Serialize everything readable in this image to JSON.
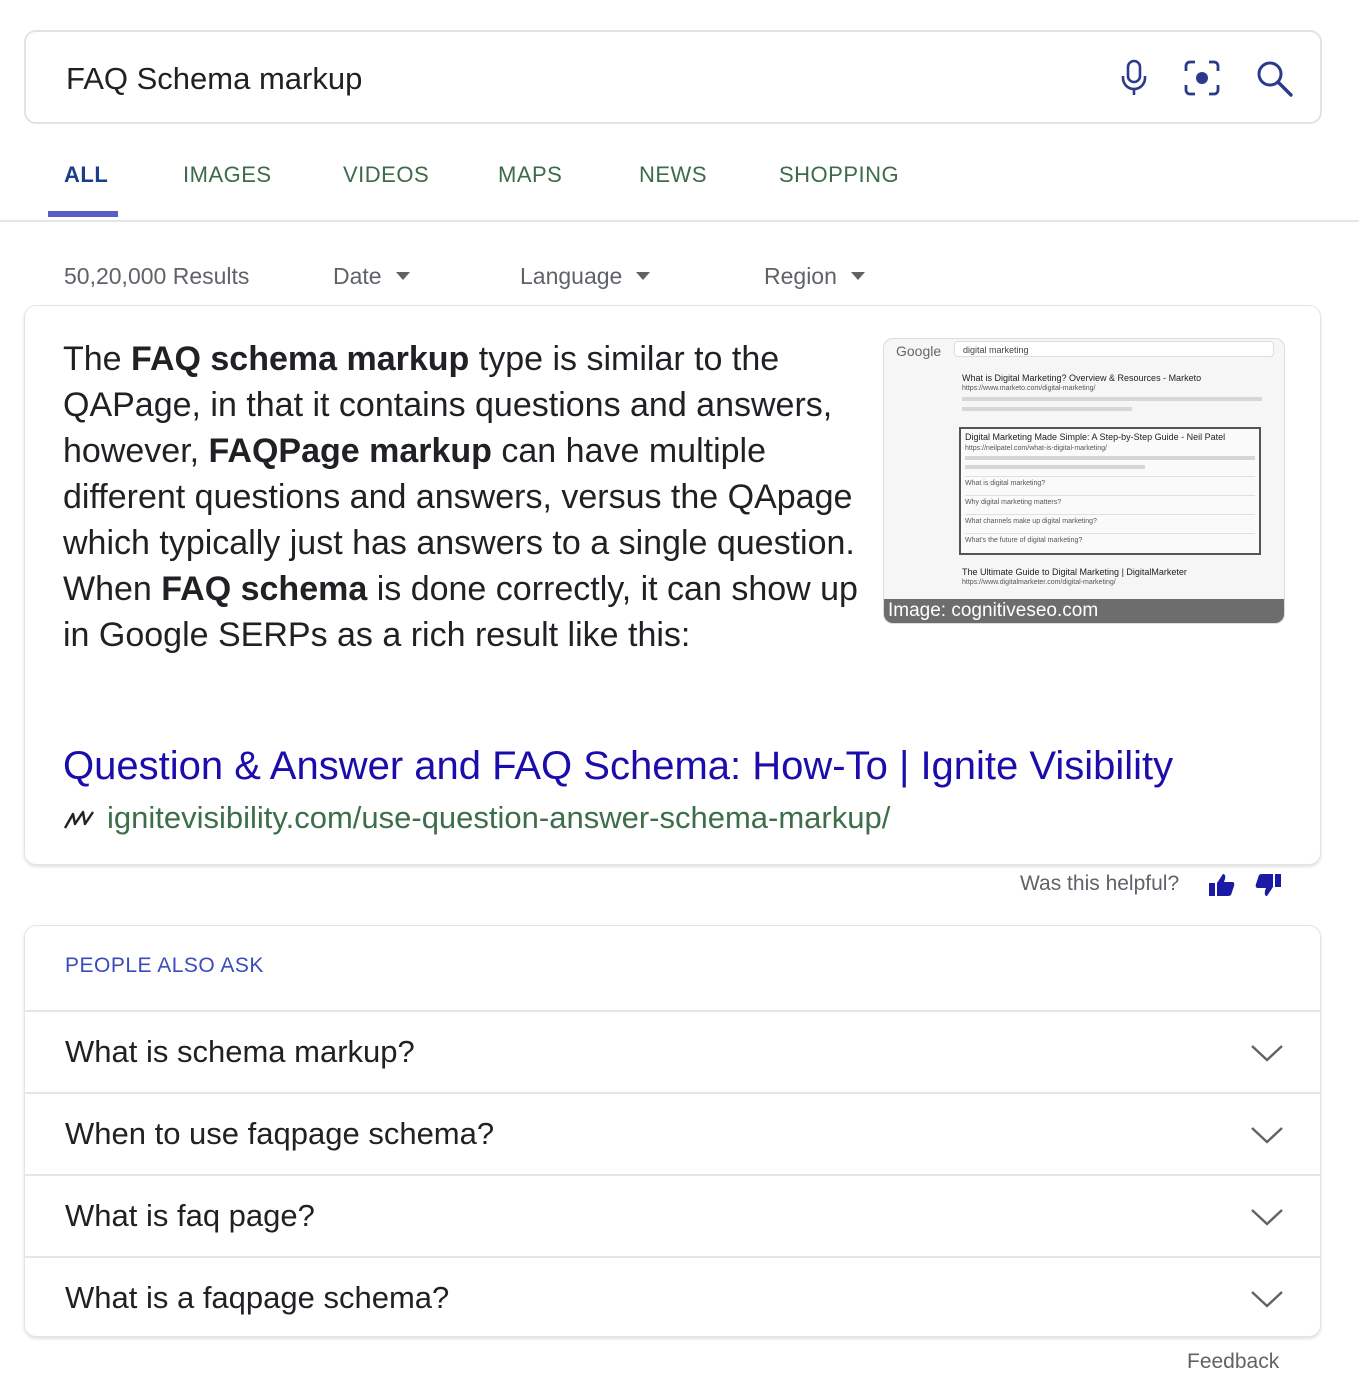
{
  "search": {
    "query": "FAQ Schema markup",
    "icons": [
      "microphone-icon",
      "lens-icon",
      "search-icon"
    ]
  },
  "tabs": [
    {
      "label": "ALL",
      "active": true
    },
    {
      "label": "IMAGES"
    },
    {
      "label": "VIDEOS"
    },
    {
      "label": "MAPS"
    },
    {
      "label": "NEWS"
    },
    {
      "label": "SHOPPING"
    }
  ],
  "filters": {
    "results_count": "50,20,000 Results",
    "date": "Date",
    "language": "Language",
    "region": "Region"
  },
  "featured": {
    "snippet": [
      {
        "t": "The ",
        "b": false
      },
      {
        "t": "FAQ schema markup",
        "b": true
      },
      {
        "t": " type is similar to the QAPage, in that it contains questions and answers, however, ",
        "b": false
      },
      {
        "t": "FAQPage markup",
        "b": true
      },
      {
        "t": " can have multiple different questions and answers, versus the QApage which typically just has answers to a single question. When ",
        "b": false
      },
      {
        "t": "FAQ schema",
        "b": true
      },
      {
        "t": " is done correctly, it can show up in Google SERPs as a rich result like this:",
        "b": false
      }
    ],
    "image_caption": "Image: cognitiveseo.com",
    "thumbnail": {
      "logo": "Google",
      "search_text": "digital marketing",
      "result1_title": "What is Digital Marketing? Overview & Resources - Marketo",
      "result1_url": "https://www.marketo.com/digital-marketing/",
      "result2_title": "Digital Marketing Made Simple: A Step-by-Step Guide - Neil Patel",
      "result2_url": "https://neilpatel.com/what-is-digital-marketing/",
      "questions": [
        "What is digital marketing?",
        "Why digital marketing matters?",
        "What channels make up digital marketing?",
        "What's the future of digital marketing?"
      ],
      "result3_title": "The Ultimate Guide to Digital Marketing | DigitalMarketer",
      "result3_url": "https://www.digitalmarketer.com/digital-marketing/"
    },
    "result_title": "Question & Answer and FAQ Schema: How-To | Ignite Visibility",
    "result_url": "ignitevisibility.com/use-question-answer-schema-markup/"
  },
  "helpful": {
    "label": "Was this helpful?"
  },
  "people_also_ask": {
    "title": "PEOPLE ALSO ASK",
    "questions": [
      "What is schema markup?",
      "When to use faqpage schema?",
      "What is faq page?",
      "What is a faqpage schema?"
    ]
  },
  "footer": {
    "feedback": "Feedback"
  },
  "colors": {
    "link": "#1a0dab",
    "url": "#3d6e4a",
    "tab_active_underline": "#5a5fc5",
    "thumb_icons": "#1a1aa6",
    "paa_title": "#3b4cb8"
  }
}
